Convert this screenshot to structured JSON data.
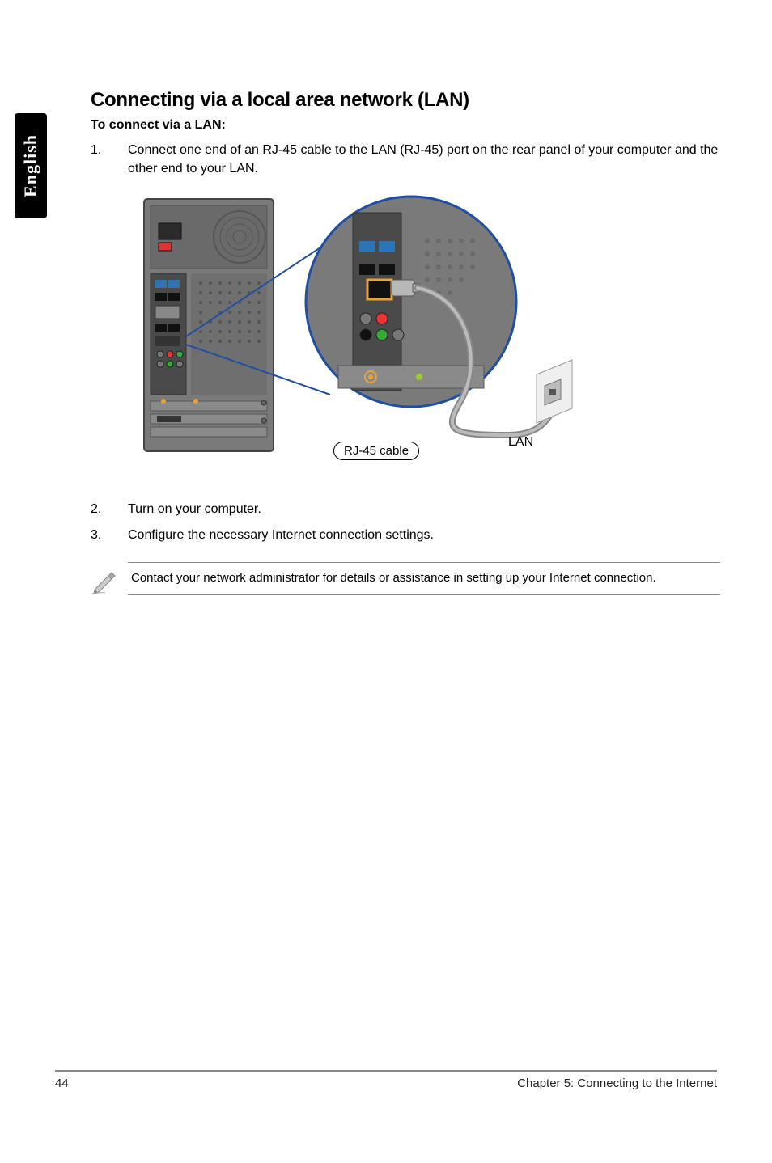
{
  "sideTab": "English",
  "heading": "Connecting via a local area network (LAN)",
  "subheading": "To connect via a LAN:",
  "steps": [
    {
      "n": "1.",
      "text": "Connect one end of an RJ-45 cable to the LAN (RJ-45) port on the rear panel of your computer and the other end to your LAN."
    },
    {
      "n": "2.",
      "text": "Turn on your computer."
    },
    {
      "n": "3.",
      "text": "Configure the necessary Internet connection settings."
    }
  ],
  "figure": {
    "cableLabel": "RJ-45 cable",
    "lanLabel": "LAN"
  },
  "note": "Contact your network administrator for details or assistance in setting up your Internet connection.",
  "footer": {
    "pageNumber": "44",
    "chapter": "Chapter 5: Connecting to the Internet"
  }
}
